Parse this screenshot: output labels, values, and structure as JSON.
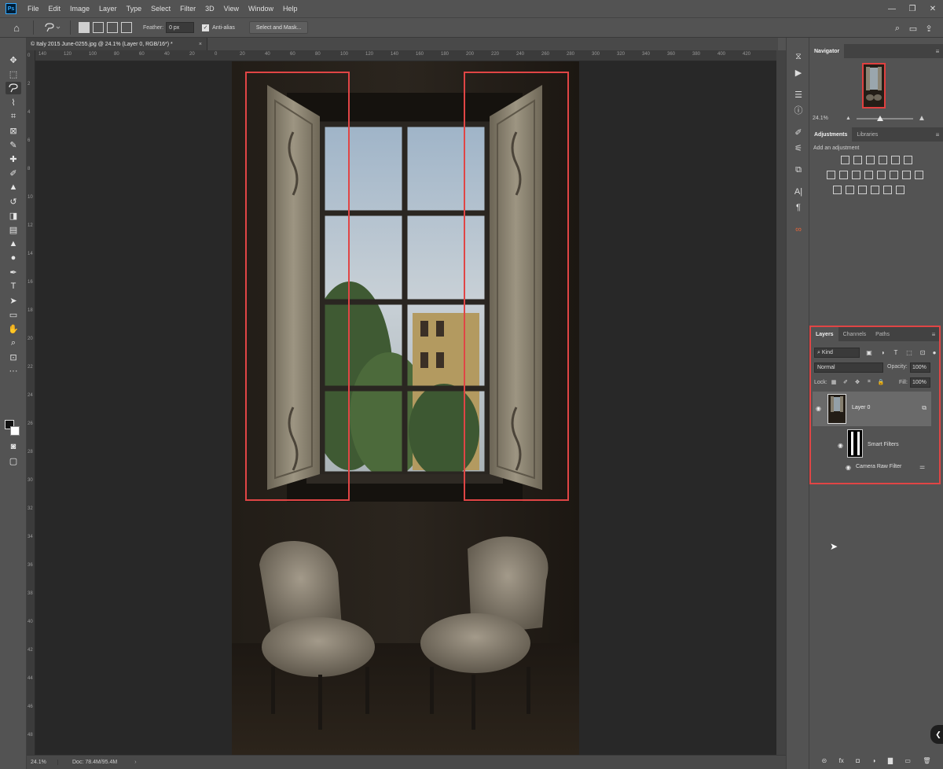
{
  "app": {
    "logo": "Ps",
    "menu": [
      "File",
      "Edit",
      "Image",
      "Layer",
      "Type",
      "Select",
      "Filter",
      "3D",
      "View",
      "Window",
      "Help"
    ],
    "window_controls": [
      "—",
      "❐",
      "✕"
    ]
  },
  "options_bar": {
    "feather_label": "Feather:",
    "feather_value": "0 px",
    "antialias_label": "Anti-alias",
    "select_mask_label": "Select and Mask..."
  },
  "document": {
    "tab_title": "© Italy 2015 June-0255.jpg @ 24.1% (Layer 0, RGB/16*) *",
    "tab_close": "×",
    "ruler_h": [
      "140",
      "120",
      "100",
      "80",
      "60",
      "40",
      "20",
      "0",
      "20",
      "40",
      "60",
      "80",
      "100",
      "120",
      "140",
      "160",
      "180",
      "200",
      "220",
      "240",
      "260",
      "280",
      "300",
      "320",
      "340",
      "360",
      "380",
      "400",
      "420"
    ],
    "ruler_v": [
      "0",
      "2",
      "4",
      "6",
      "8",
      "10",
      "12",
      "14",
      "16",
      "18",
      "20",
      "22",
      "24",
      "26",
      "28",
      "30",
      "32",
      "34",
      "36",
      "38",
      "40",
      "42",
      "44",
      "46",
      "48"
    ]
  },
  "status_bar": {
    "zoom": "24.1%",
    "doc_info": "Doc: 78.4M/95.4M",
    "arrow": "›"
  },
  "navigator": {
    "tab": "Navigator",
    "zoom": "24.1%"
  },
  "adjustments": {
    "tabs": [
      "Adjustments",
      "Libraries"
    ],
    "hint": "Add an adjustment"
  },
  "layers": {
    "tabs": [
      "Layers",
      "Channels",
      "Paths"
    ],
    "filter_kind": "Kind",
    "blend_mode": "Normal",
    "opacity_label": "Opacity:",
    "opacity": "100%",
    "lock_label": "Lock:",
    "fill_label": "Fill:",
    "fill": "100%",
    "layer_name": "Layer 0",
    "smart_filters": "Smart Filters",
    "camera_raw": "Camera Raw Filter",
    "footer": [
      "⊝",
      "fx",
      "◘",
      "◑",
      "▇",
      "▭",
      "🗑"
    ]
  },
  "colors": {
    "highlight": "#e04545",
    "ps_blue": "#31a8ff"
  }
}
